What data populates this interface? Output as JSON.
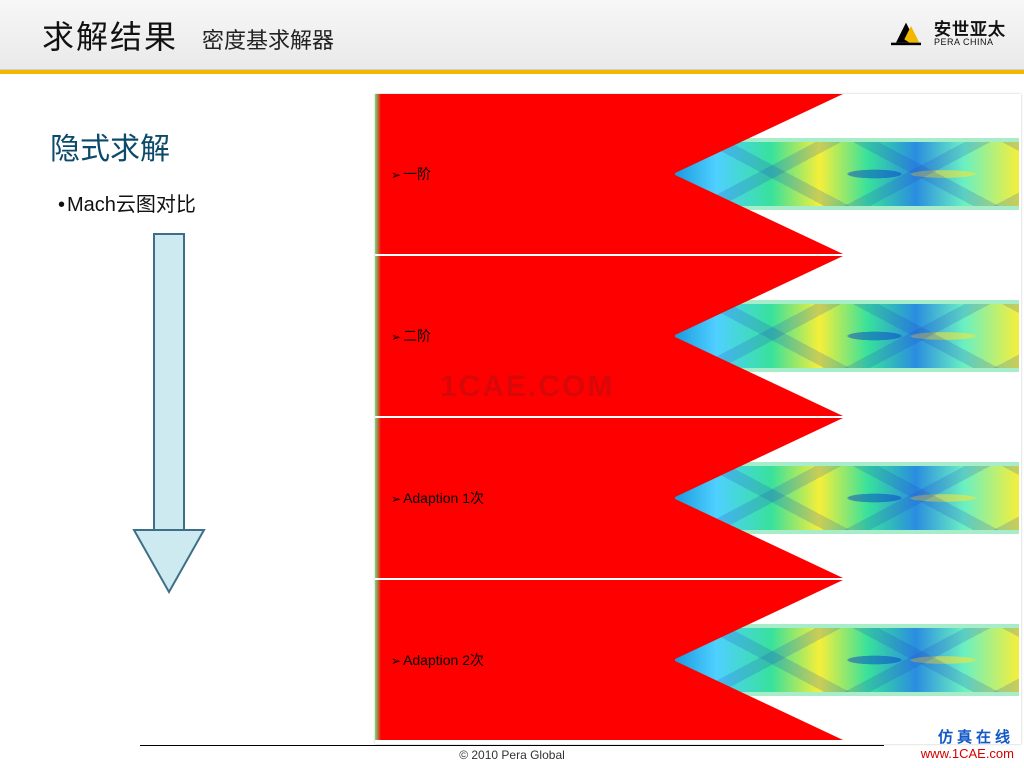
{
  "header": {
    "title": "求解结果",
    "subtitle": "密度基求解器",
    "brand_cn": "安世亚太",
    "brand_en": "PERA CHINA"
  },
  "left": {
    "section_title": "隐式求解",
    "bullet": "Mach云图对比"
  },
  "rows": [
    {
      "label": "一阶"
    },
    {
      "label": "二阶"
    },
    {
      "label": "Adaption 1次"
    },
    {
      "label": "Adaption 2次"
    }
  ],
  "watermark": "1CAE.COM",
  "footer": "© 2010 Pera Global",
  "site": {
    "cn": "仿真在线",
    "url": "www.1CAE.com"
  },
  "colors": {
    "header_stripe": "#f3b700",
    "title_blue": "#0b4a6b",
    "red": "#ff0000"
  }
}
